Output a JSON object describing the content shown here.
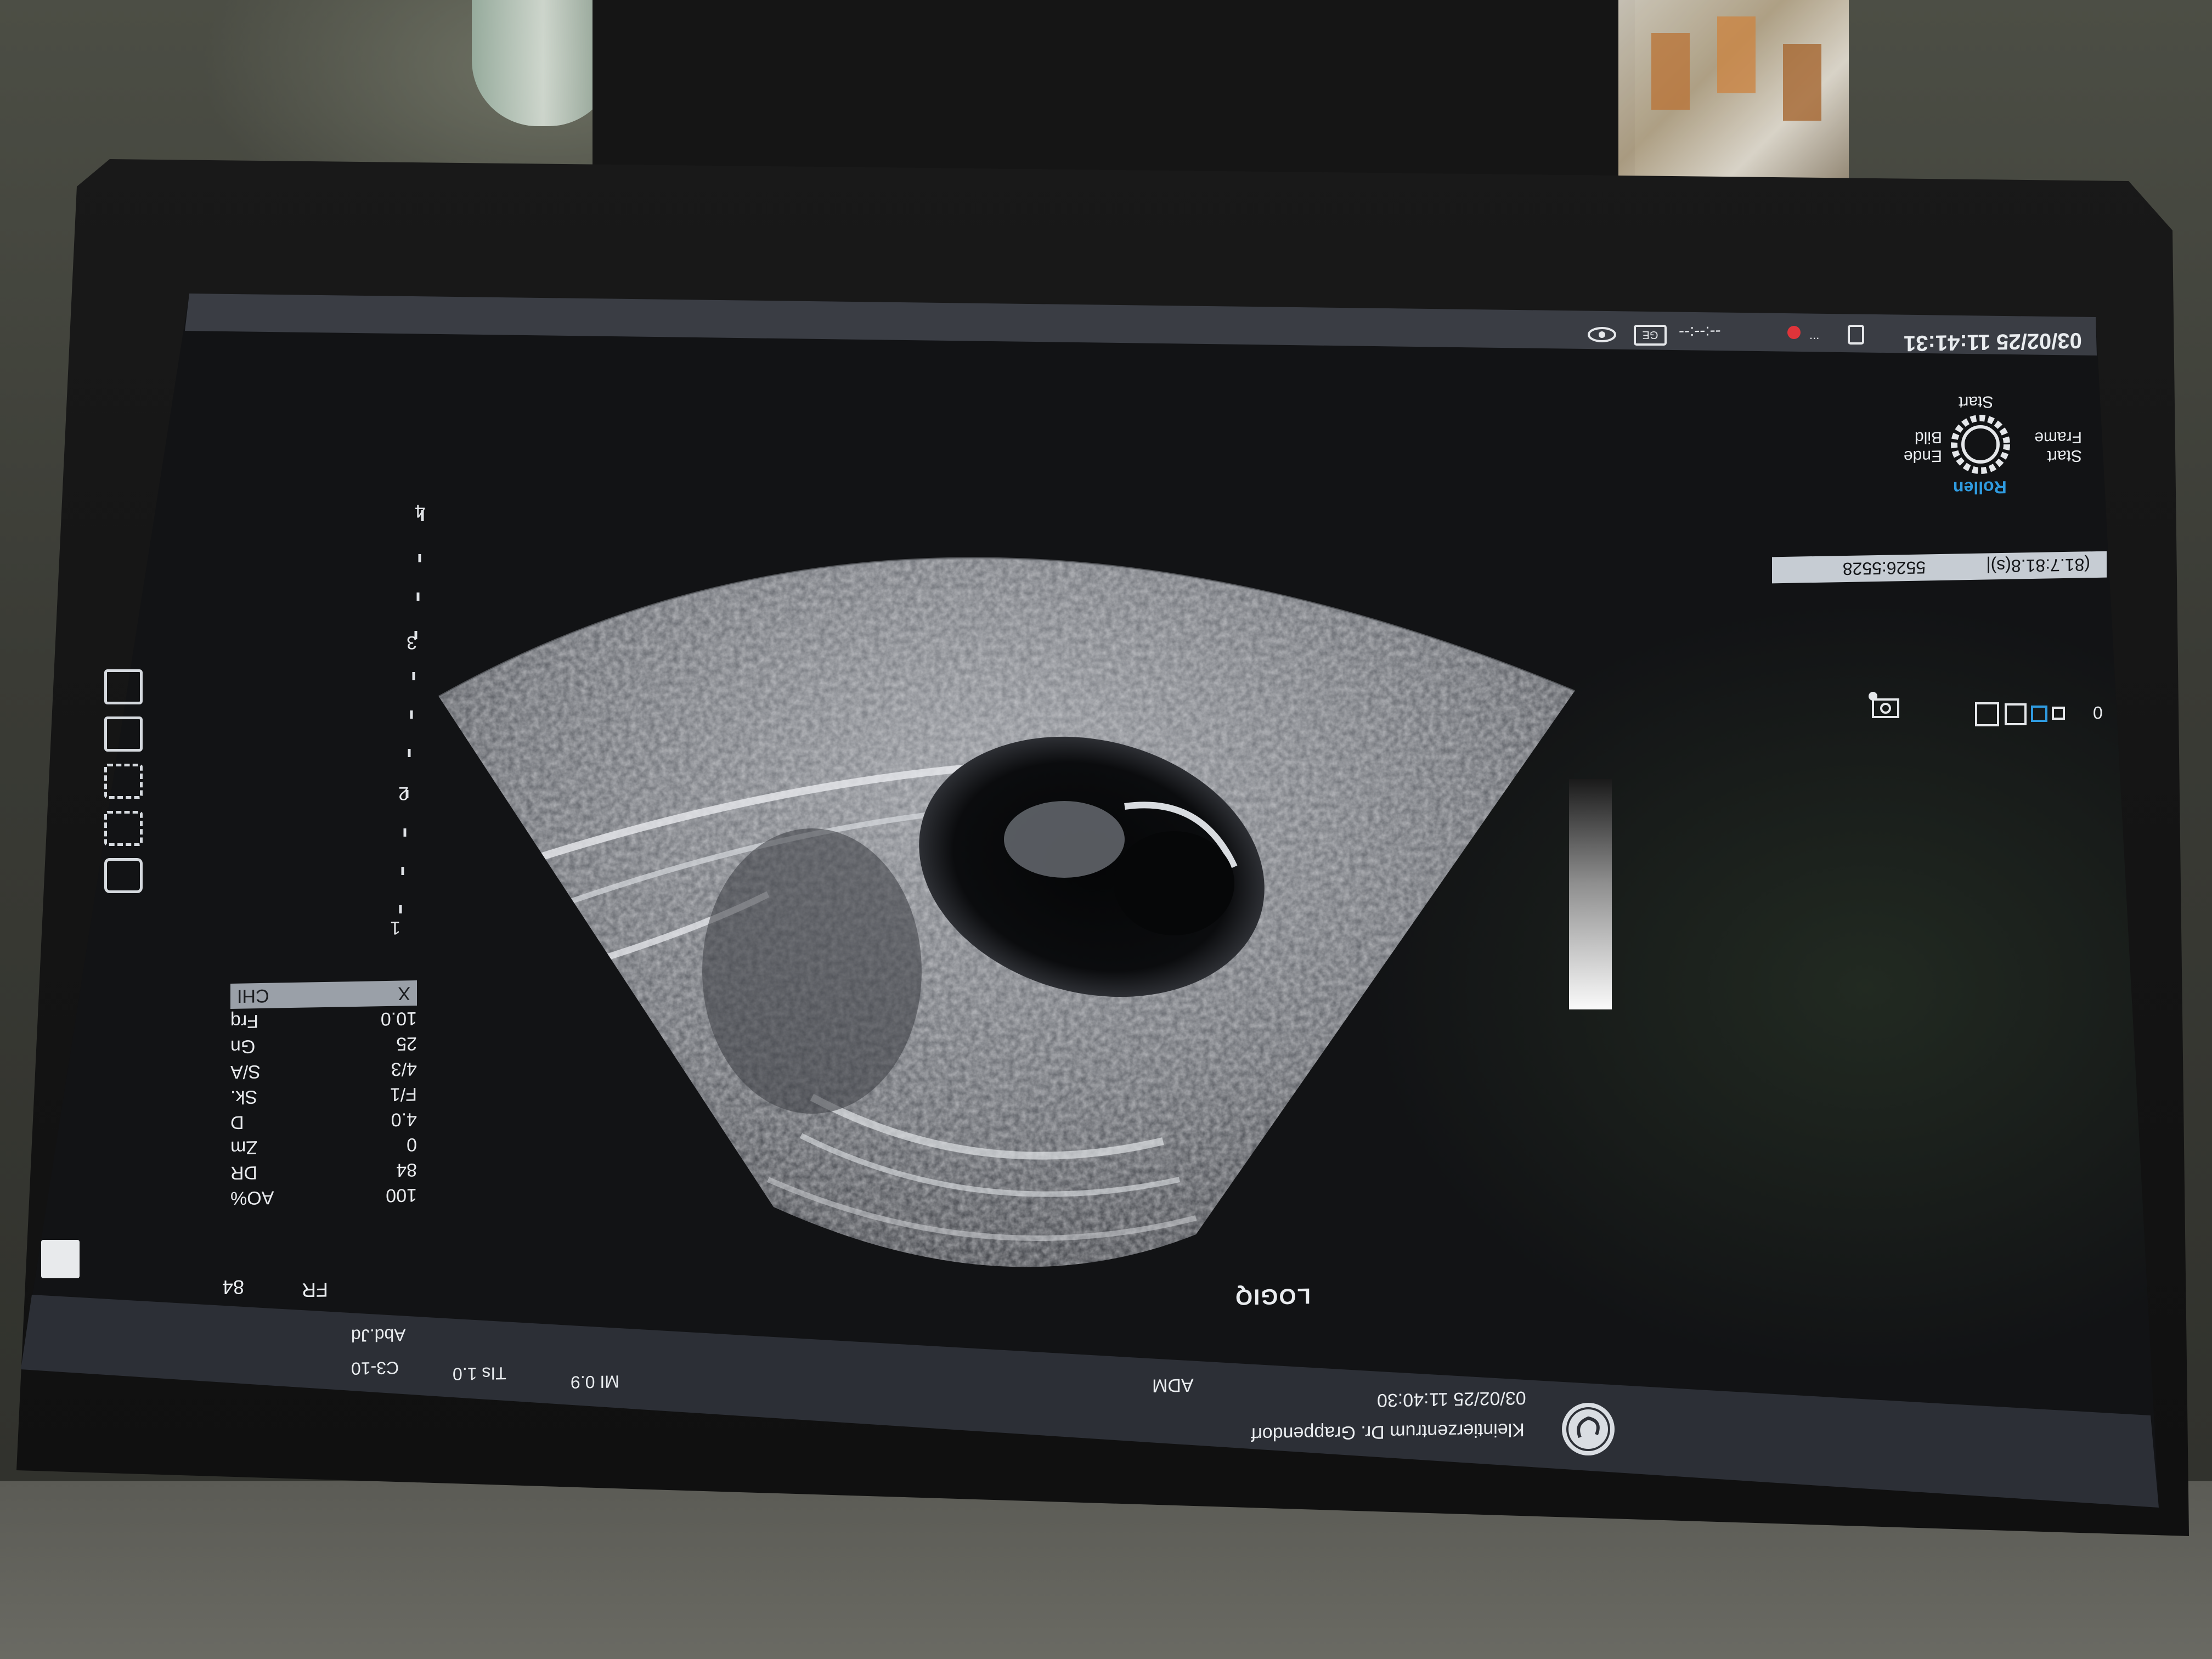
{
  "status_bar": {
    "datetime": "03/02/25 11:41:31",
    "clock_readout": "--:--:--"
  },
  "footer": {
    "clinic": "Kleintierzentrum Dr. Grappendorf",
    "acquired": "03/02/25 11:40:30",
    "mode": "ADM",
    "mi": "MI 0.9",
    "tis": "TIs 1.0",
    "probe": "C3-10",
    "preset": "Abd.Jd",
    "brand_logo": "LOGIQ"
  },
  "fr": {
    "label": "FR",
    "value": "84"
  },
  "cine": {
    "frames": "5526:5528",
    "time": "(81.7:81.8(s)|"
  },
  "rollen": {
    "title": "Rollen",
    "start_frame": "Start Frame",
    "ende_bild": "Ende Bild",
    "start": "Start"
  },
  "view_indicator": {
    "zero": "0"
  },
  "params": [
    {
      "label": "CHI",
      "value": "X"
    },
    {
      "label": "Frq",
      "value": "10.0"
    },
    {
      "label": "Gn",
      "value": "25"
    },
    {
      "label": "S/A",
      "value": "4/3"
    },
    {
      "label": "Sk.",
      "value": "F/1"
    },
    {
      "label": "D",
      "value": "4.0"
    },
    {
      "label": "Zm",
      "value": "0"
    },
    {
      "label": "DR",
      "value": "84"
    },
    {
      "label": "AO%",
      "value": "100"
    }
  ],
  "depth_scale": {
    "labels": [
      "1",
      "2",
      "3",
      "4"
    ]
  },
  "icons": {
    "status": [
      "eye-icon",
      "ge-icon",
      "clock-icon",
      "record-icon",
      "probe-icon"
    ],
    "side": [
      "camera-icon",
      "swap-icon",
      "grid-add-icon",
      "grid-icon",
      "frame-icon"
    ],
    "footer": "ge-monogram-icon"
  },
  "colors": {
    "screen_bg": "#121315",
    "status_bar": "#3a3d44",
    "cine_box": "#c6ccd3",
    "rollen_accent": "#2f9be0",
    "active_square": "#2f9be0"
  }
}
